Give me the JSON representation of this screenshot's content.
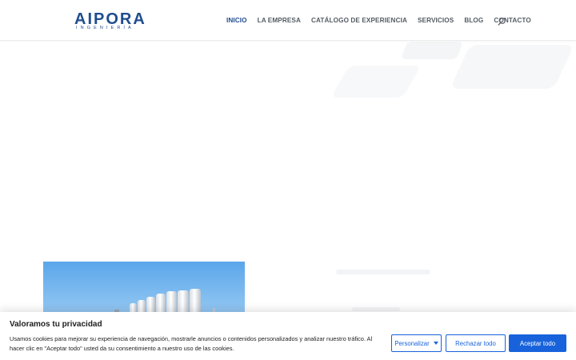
{
  "brand": {
    "name": "AIPORA",
    "tagline": "INGENIERÍA",
    "color": "#1f4d8f"
  },
  "nav": {
    "items": [
      {
        "label": "INICIO",
        "active": true
      },
      {
        "label": "LA EMPRESA",
        "active": false
      },
      {
        "label": "CATÁLOGO DE EXPERIENCIA",
        "active": false
      },
      {
        "label": "SERVICIOS",
        "active": false
      },
      {
        "label": "BLOG",
        "active": false
      },
      {
        "label": "CONTACTO",
        "active": false
      }
    ],
    "search_icon": "search-icon"
  },
  "cookie_banner": {
    "title": "Valoramos tu privacidad",
    "text": "Usamos cookies para mejorar su experiencia de navegación, mostrarle anuncios o contenidos personalizados y analizar nuestro tráfico. Al hacer clic en \"Aceptar todo\" usted da su consentimiento a nuestro uso de las cookies.",
    "customize_label": "Personalizar",
    "reject_label": "Rechazar todo",
    "accept_label": "Aceptar todo",
    "accent_color": "#1863dc"
  }
}
